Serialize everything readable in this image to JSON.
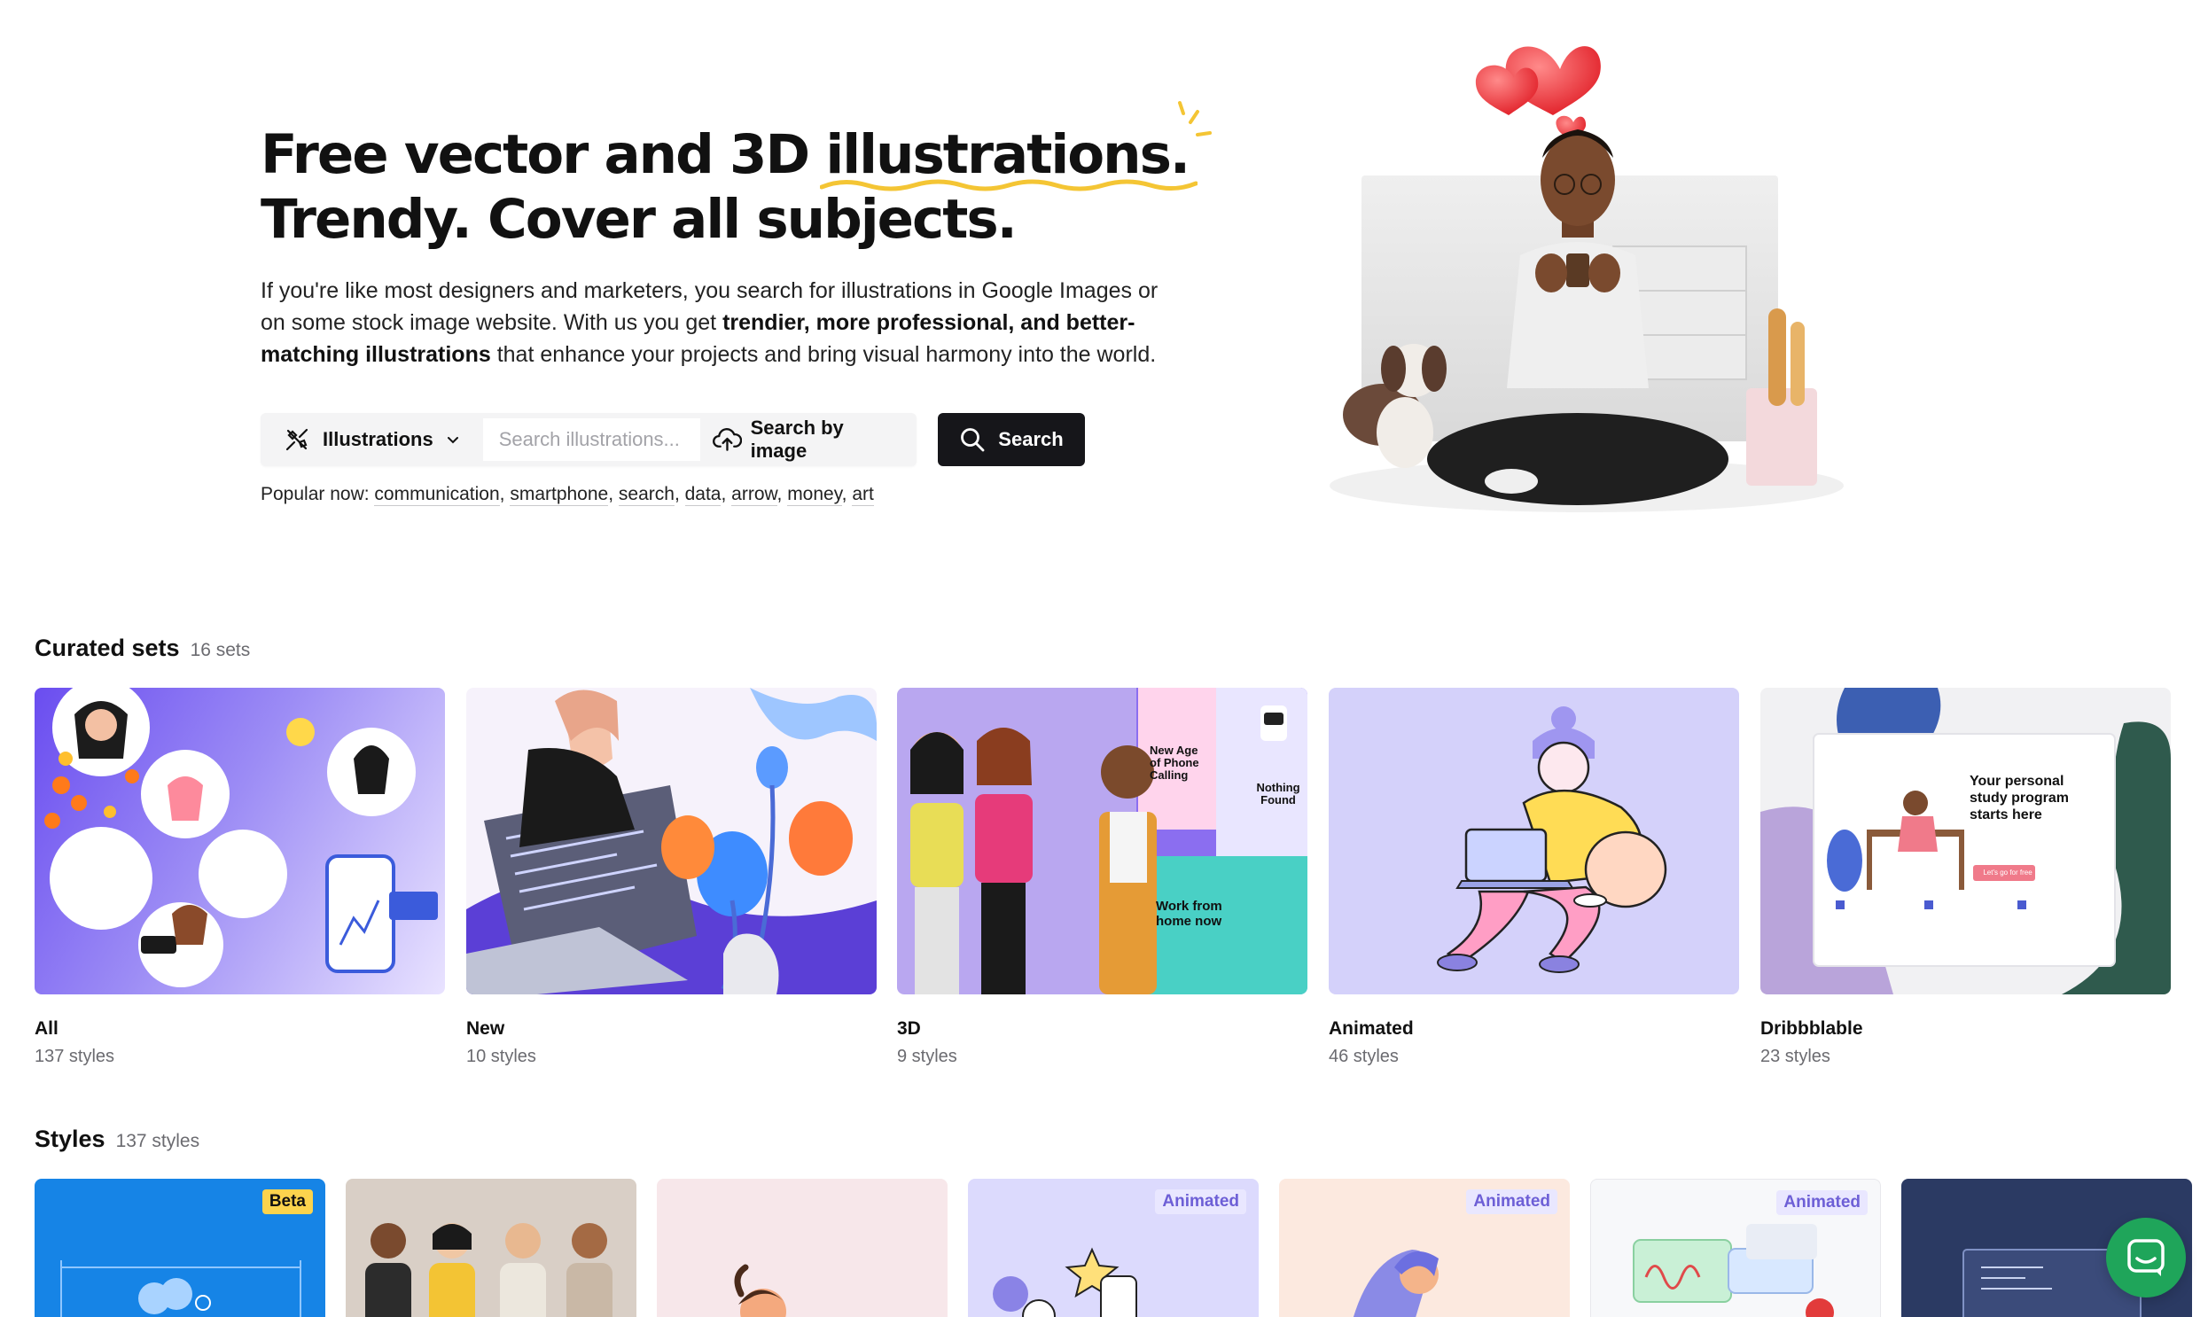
{
  "hero": {
    "headline_line1_pre": "Free vector and 3D ",
    "headline_highlight": "illustrations.",
    "headline_line2": "Trendy. Cover all subjects.",
    "desc_part1": "If you're like most designers and marketers, you search for illustrations in Google Images or on some stock image website. With us you get ",
    "desc_bold": "trendier, more professional, and better-matching illustrations",
    "desc_part2": " that enhance your projects and bring visual harmony into the world."
  },
  "search": {
    "type_label": "Illustrations",
    "placeholder": "Search illustrations...",
    "by_image_label": "Search by image",
    "button_label": "Search",
    "popular_label": "Popular now:",
    "popular_tags": [
      "communication",
      "smartphone",
      "search",
      "data",
      "arrow",
      "money",
      "art"
    ]
  },
  "curated": {
    "title": "Curated sets",
    "count": "16 sets",
    "items": [
      {
        "name": "All",
        "count": "137 styles"
      },
      {
        "name": "New",
        "count": "10 styles"
      },
      {
        "name": "3D",
        "count": "9 styles"
      },
      {
        "name": "Animated",
        "count": "46 styles"
      },
      {
        "name": "Dribbblable",
        "count": "23 styles"
      }
    ],
    "thumb_texts": {
      "phone_calling": "New Age of Phone Calling",
      "nothing_found": "Nothing Found",
      "work_from_home": "Work from home now",
      "study_program": "Your personal study program starts here",
      "lets_go": "Let's go for free"
    }
  },
  "styles": {
    "title": "Styles",
    "count": "137 styles",
    "badges": {
      "beta": "Beta",
      "animated": "Animated"
    }
  },
  "colors": {
    "accent_yellow": "#f4c534",
    "button_dark": "#16161a",
    "chat_green": "#1fa55a"
  }
}
